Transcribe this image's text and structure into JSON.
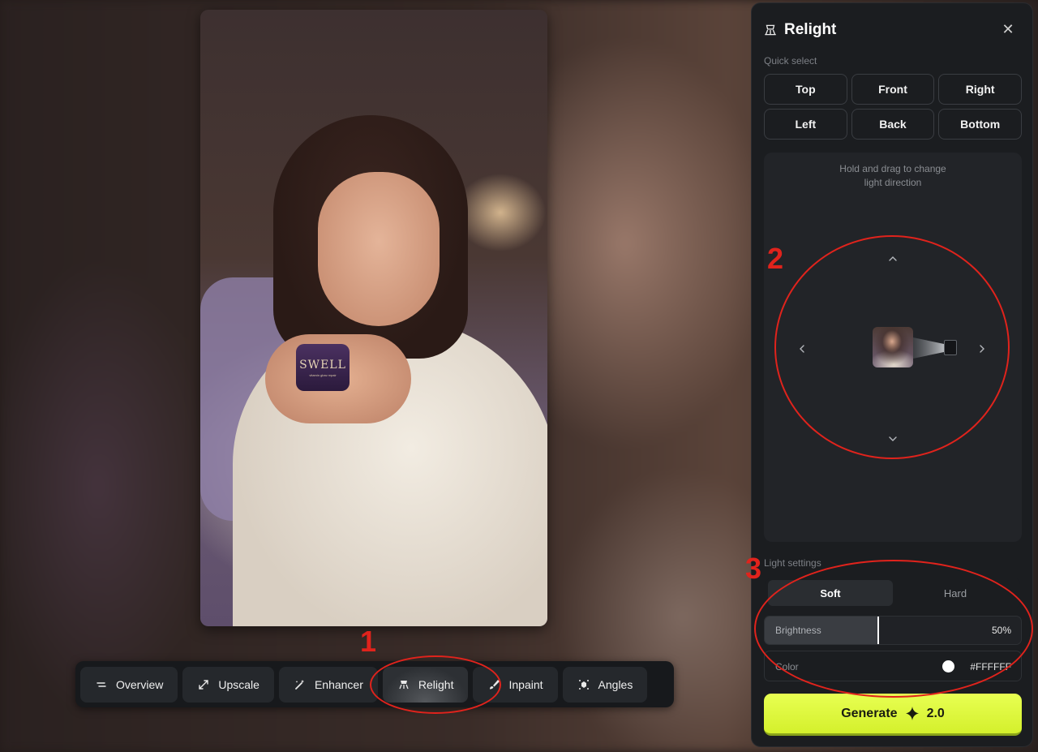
{
  "canvas": {
    "brand_text": "SWELL",
    "jar_subtext": "vitamin glow repair"
  },
  "toolbar": {
    "items": [
      {
        "label": "Overview",
        "icon": "list-icon"
      },
      {
        "label": "Upscale",
        "icon": "expand-arrows-icon"
      },
      {
        "label": "Enhancer",
        "icon": "magic-wand-icon"
      },
      {
        "label": "Relight",
        "icon": "relight-icon",
        "active": true
      },
      {
        "label": "Inpaint",
        "icon": "brush-icon"
      },
      {
        "label": "Angles",
        "icon": "angles-icon"
      }
    ]
  },
  "panel": {
    "title": "Relight",
    "close_icon": "close-icon",
    "quick_select_label": "Quick select",
    "quick_select": [
      "Top",
      "Front",
      "Right",
      "Left",
      "Back",
      "Bottom"
    ],
    "direction_hint_line1": "Hold and drag to change",
    "direction_hint_line2": "light direction",
    "light_settings_label": "Light settings",
    "modes": [
      "Soft",
      "Hard"
    ],
    "active_mode": "Soft",
    "brightness_label": "Brightness",
    "brightness_value": "50%",
    "brightness_fraction": 0.44,
    "color_label": "Color",
    "color_value": "#FFFFFF",
    "generate_label": "Generate",
    "generate_cost": "2.0"
  },
  "annotations": {
    "one": "1",
    "two": "2",
    "three": "3"
  },
  "colors": {
    "accent": "#E0FA3C",
    "annotation": "#E0231C",
    "panel_bg": "#1B1D20"
  }
}
